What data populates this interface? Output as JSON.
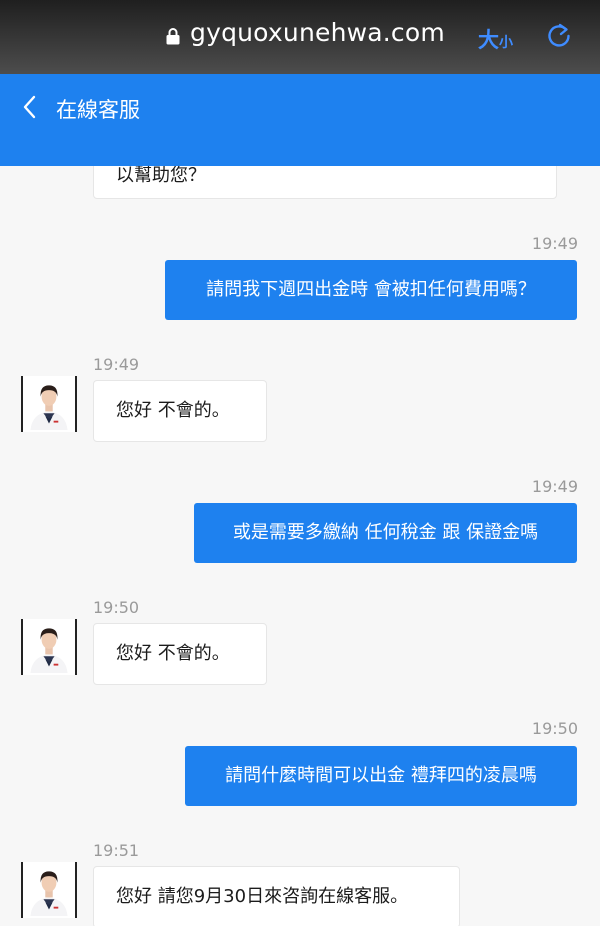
{
  "browser": {
    "url": "gyquoxunehwa.com",
    "text_size_big": "大",
    "text_size_small": "小"
  },
  "header": {
    "title": "在線客服"
  },
  "messages": [
    {
      "sender": "agent",
      "time": "",
      "text": "以幫助您？"
    },
    {
      "sender": "user",
      "time": "19:49",
      "text": "請問我下週四出金時 會被扣任何費用嗎？"
    },
    {
      "sender": "agent",
      "time": "19:49",
      "text": "您好 不會的。"
    },
    {
      "sender": "user",
      "time": "19:49",
      "text": "或是需要多繳納 任何稅金 跟 保證金嗎"
    },
    {
      "sender": "agent",
      "time": "19:50",
      "text": "您好 不會的。"
    },
    {
      "sender": "user",
      "time": "19:50",
      "text": "請問什麼時間可以出金 禮拜四的凌晨嗎"
    },
    {
      "sender": "agent",
      "time": "19:51",
      "text": "您好 請您9月30日來咨詢在線客服。"
    }
  ],
  "colors": {
    "accent": "#1e81ef",
    "address_bar": "#333333",
    "chat_background": "#f7f7f7",
    "timestamp": "#9a9a9a"
  },
  "icons": {
    "lock": "lock-icon",
    "refresh": "refresh-icon",
    "back": "chevron-left-icon",
    "avatar": "agent-avatar"
  }
}
